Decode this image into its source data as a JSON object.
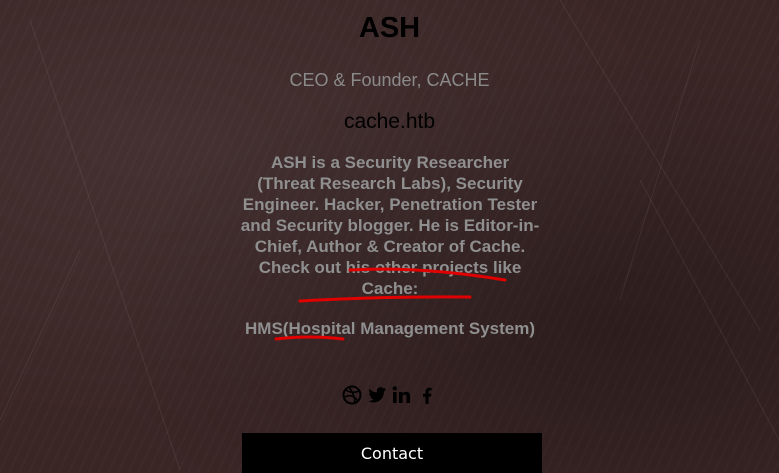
{
  "profile": {
    "name": "ASH",
    "title": "CEO & Founder, CACHE",
    "domain": "cache.htb",
    "bio": "ASH is a Security Researcher (Threat Research Labs), Security Engineer. Hacker, Penetration Tester and Security blogger. He is Editor-in-Chief, Author & Creator of Cache. Check out his other projects like Cache:",
    "project": "HMS(Hospital Management System)"
  },
  "social": [
    "dribbble-icon",
    "twitter-icon",
    "linkedin-icon",
    "facebook-icon"
  ],
  "contact_label": "Contact",
  "colors": {
    "background": "#3b2626",
    "muted_text": "#8f8f8f",
    "annotation": "#e00000",
    "button": "#000000"
  }
}
